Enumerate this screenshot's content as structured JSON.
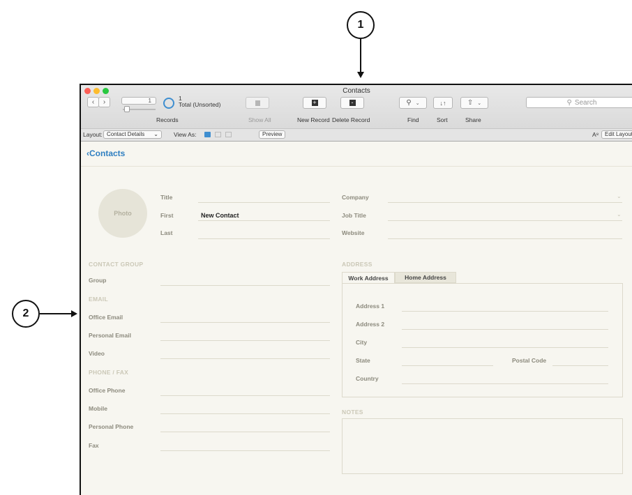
{
  "callouts": {
    "one": "1",
    "two": "2"
  },
  "window": {
    "title": "Contacts"
  },
  "toolbar": {
    "record_number": "1",
    "total_count": "1",
    "total_label": "Total (Unsorted)",
    "records_label": "Records",
    "show_all_label": "Show All",
    "new_record_label": "New Record",
    "delete_record_label": "Delete Record",
    "find_label": "Find",
    "sort_label": "Sort",
    "share_label": "Share",
    "search_placeholder": "Search"
  },
  "layoutbar": {
    "layout_label": "Layout:",
    "layout_value": "Contact Details",
    "view_as_label": "View As:",
    "preview_label": "Preview",
    "edit_layout_label": "Edit Layout"
  },
  "nav": {
    "back_label": "Contacts"
  },
  "contact": {
    "photo_label": "Photo",
    "title_label": "Title",
    "first_label": "First",
    "first_value": "New Contact",
    "last_label": "Last",
    "company_label": "Company",
    "job_title_label": "Job Title",
    "website_label": "Website"
  },
  "contact_group": {
    "heading": "CONTACT GROUP",
    "group_label": "Group"
  },
  "email": {
    "heading": "EMAIL",
    "office_label": "Office Email",
    "personal_label": "Personal Email",
    "video_label": "Video"
  },
  "phone": {
    "heading": "PHONE / FAX",
    "office_label": "Office Phone",
    "mobile_label": "Mobile",
    "personal_label": "Personal Phone",
    "fax_label": "Fax"
  },
  "address": {
    "heading": "ADDRESS",
    "tabs": [
      "Work Address",
      "Home Address"
    ],
    "address1_label": "Address 1",
    "address2_label": "Address 2",
    "city_label": "City",
    "state_label": "State",
    "postal_label": "Postal Code",
    "country_label": "Country"
  },
  "notes": {
    "heading": "NOTES"
  },
  "colors": {
    "accent": "#2f7fc1",
    "background": "#f7f6f0",
    "label": "#8c8a7d",
    "section": "#cbc8b7"
  }
}
